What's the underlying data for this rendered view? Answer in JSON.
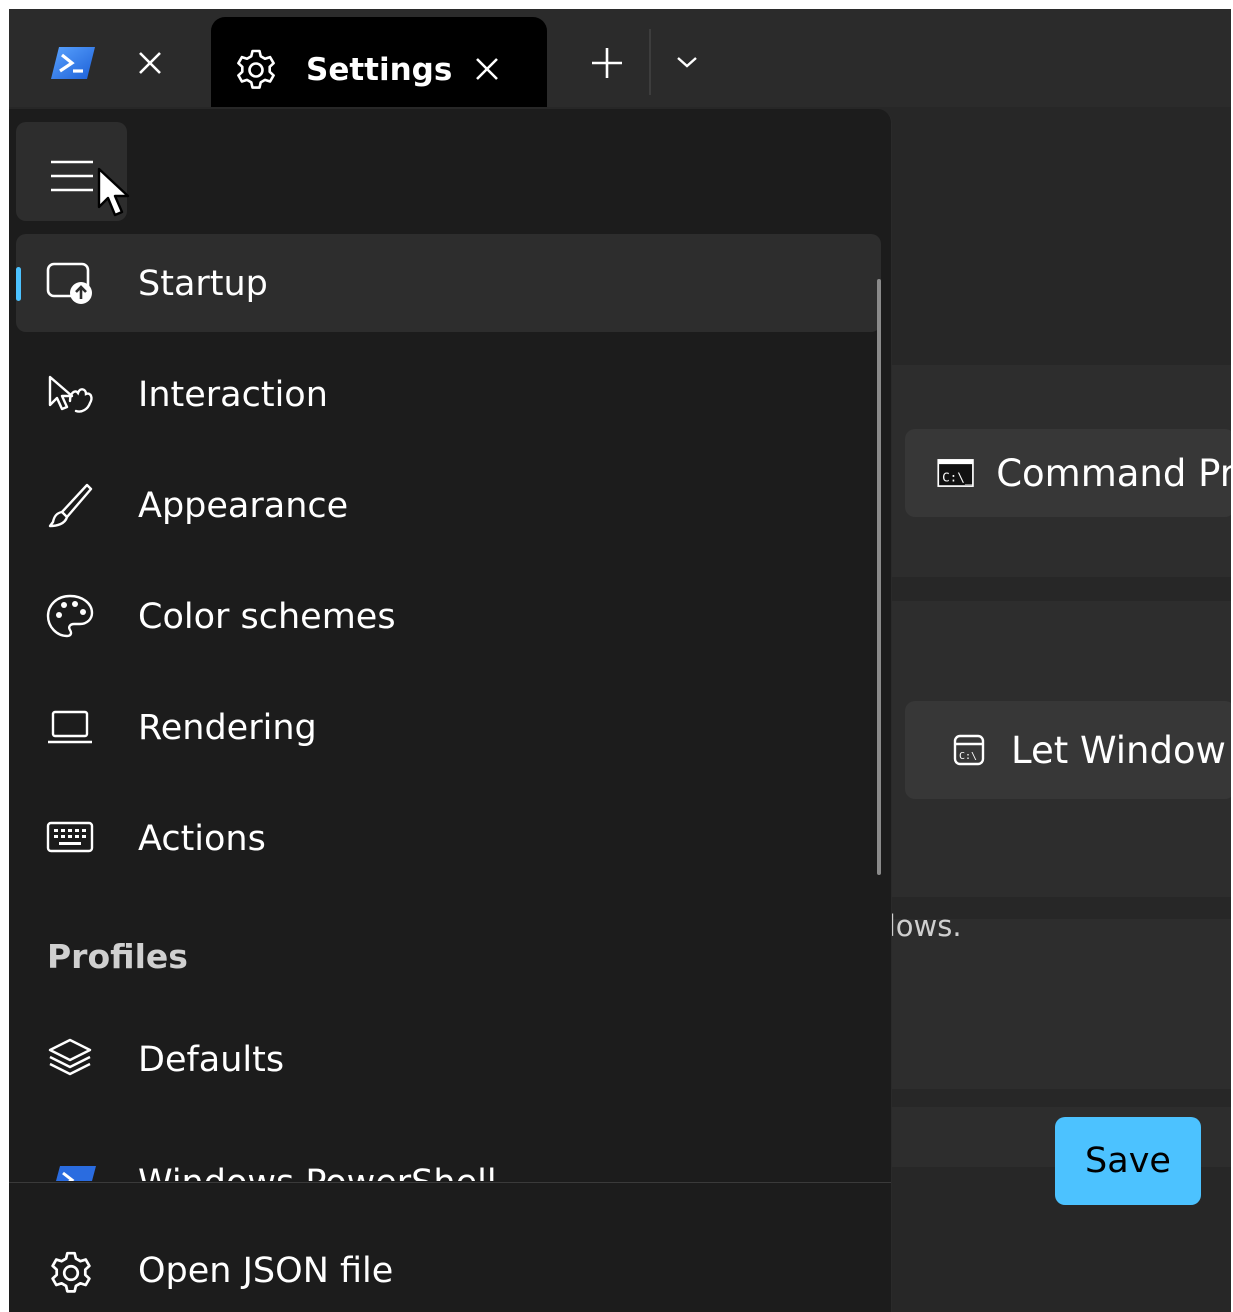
{
  "window": {
    "tabs": [
      {
        "label": "",
        "icon": "powershell-icon",
        "close_icon": "close-icon"
      },
      {
        "label": "Settings",
        "icon": "gear-icon",
        "close_icon": "close-icon",
        "active": true
      }
    ],
    "new_tab_icon": "plus-icon",
    "dropdown_icon": "chevron-down-icon"
  },
  "colors": {
    "accent": "#4cc2ff",
    "nav_background": "#1c1c1c",
    "content_background": "#272727",
    "tabbar_background": "#2b2b2b"
  },
  "nav": {
    "toggle_icon": "hamburger-icon",
    "items": [
      {
        "label": "Startup",
        "icon": "startup-icon",
        "selected": true
      },
      {
        "label": "Interaction",
        "icon": "interaction-icon"
      },
      {
        "label": "Appearance",
        "icon": "paintbrush-icon"
      },
      {
        "label": "Color schemes",
        "icon": "palette-icon"
      },
      {
        "label": "Rendering",
        "icon": "laptop-icon"
      },
      {
        "label": "Actions",
        "icon": "keyboard-icon"
      }
    ],
    "section_header": "Profiles",
    "profile_items": [
      {
        "label": "Defaults",
        "icon": "layers-icon"
      },
      {
        "label": "Windows PowerShell",
        "icon": "powershell-icon",
        "partially_visible": true
      }
    ],
    "footer": {
      "label": "Open JSON file",
      "icon": "gear-icon"
    }
  },
  "content": {
    "default_profile_value": "Command Pr",
    "default_profile_icon": "cmd-icon",
    "terminal_app_value": "Let Window",
    "terminal_app_icon": "terminal-app-icon",
    "description_fragment": "ndows.",
    "save_label": "Save"
  }
}
